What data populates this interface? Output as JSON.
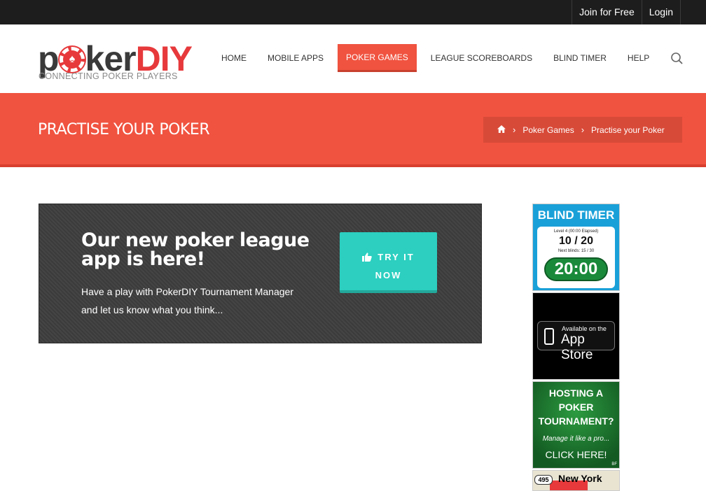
{
  "topbar": {
    "join_label": "Join for Free",
    "login_label": "Login"
  },
  "logo": {
    "text_left": "p",
    "text_mid": "ker",
    "text_right": "DIY",
    "chip_symbol": "♠",
    "tagline": "CONNECTING POKER PLAYERS"
  },
  "nav": {
    "items": [
      {
        "label": "HOME",
        "active": false
      },
      {
        "label": "MOBILE APPS",
        "active": false
      },
      {
        "label": "POKER GAMES",
        "active": true
      },
      {
        "label": "LEAGUE SCOREBOARDS",
        "active": false
      },
      {
        "label": "BLIND TIMER",
        "active": false
      },
      {
        "label": "HELP",
        "active": false
      }
    ],
    "search_icon": "search-icon"
  },
  "titlebar": {
    "title": "PRACTISE YOUR POKER",
    "breadcrumb": {
      "home_icon": "home-icon",
      "parent": "Poker Games",
      "current": "Practise your Poker"
    }
  },
  "promo": {
    "heading": "Our new poker league app is here!",
    "body": "Have a play with PokerDIY Tournament Manager and let us know what you think...",
    "button_label": "TRY IT NOW",
    "button_icon": "thumbs-up-icon"
  },
  "sidebar": {
    "ad1": {
      "title": "BLIND TIMER",
      "level": "Level 4 (00:00 Elapsed)",
      "blinds": "10 / 20",
      "next": "Next blinds: 15 / 30",
      "clock": "20:00"
    },
    "ad2": {
      "line1": "Available on the",
      "line2": "App Store"
    },
    "ad3": {
      "heading": "HOSTING A POKER TOURNAMENT?",
      "sub": "Manage it like a pro...",
      "cta": "CLICK HERE!",
      "mark": "BF"
    },
    "ad4": {
      "road": "495",
      "city": "New York"
    }
  },
  "colors": {
    "accent": "#f05340",
    "teal": "#2ccfc0",
    "dark": "#1d1d1d"
  }
}
